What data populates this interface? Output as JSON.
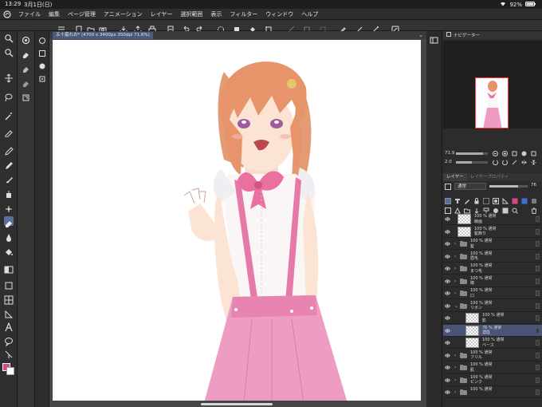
{
  "status": {
    "time": "13:29",
    "date": "3月1日(日)",
    "battery": "92%"
  },
  "menu": [
    "ファイル",
    "編集",
    "ページ管理",
    "アニメーション",
    "レイヤー",
    "選択範囲",
    "表示",
    "フィルター",
    "ウィンドウ",
    "ヘルプ"
  ],
  "canvas_tab": {
    "title": "五十嵐れお* (4700 x 3400px 350dpi 71.6%)"
  },
  "navigator": {
    "title": "ナビゲーター",
    "zoom": "71.9",
    "rotation": "2.0"
  },
  "layer_panel": {
    "tab_layer": "レイヤー",
    "tab_property": "レイヤープロパティ",
    "blend_mode": "通常",
    "opacity": "76",
    "opacity_fraction": 0.76,
    "layers": [
      {
        "meta": "100 % 通常",
        "name": "線画",
        "kind": "raster",
        "indent": 0
      },
      {
        "meta": "100 % 通常",
        "name": "髪飾り",
        "kind": "raster",
        "indent": 0
      },
      {
        "meta": "100 % 通常",
        "name": "髪",
        "kind": "folder",
        "indent": 0
      },
      {
        "meta": "100 % 通常",
        "name": "眉毛",
        "kind": "folder",
        "indent": 0
      },
      {
        "meta": "100 % 通常",
        "name": "まつ毛",
        "kind": "folder",
        "indent": 0
      },
      {
        "meta": "100 % 通常",
        "name": "瞳",
        "kind": "folder",
        "indent": 0
      },
      {
        "meta": "100 % 通常",
        "name": "口",
        "kind": "folder",
        "indent": 0
      },
      {
        "meta": "100 % 通常",
        "name": "リボン",
        "kind": "folder",
        "indent": 0,
        "open": true
      },
      {
        "meta": "100 % 通常",
        "name": "影",
        "kind": "raster",
        "indent": 1,
        "clip": true
      },
      {
        "meta": "76 % 通常",
        "name": "濃陰",
        "kind": "raster",
        "indent": 1,
        "clip": true,
        "selected": true
      },
      {
        "meta": "100 % 通常",
        "name": "ベース",
        "kind": "raster",
        "indent": 1
      },
      {
        "meta": "100 % 通常",
        "name": "フリル",
        "kind": "folder",
        "indent": 0
      },
      {
        "meta": "100 % 通常",
        "name": "肌",
        "kind": "folder",
        "indent": 0
      },
      {
        "meta": "100 % 通常",
        "name": "ピンク",
        "kind": "folder",
        "indent": 0
      },
      {
        "meta": "100 % 通常",
        "name": "",
        "kind": "folder",
        "indent": 0
      }
    ]
  },
  "colors": {
    "main": "#d44a86",
    "sub": "#ffffff",
    "accent": "#4a5478",
    "nav_frame": "#ff3a3a"
  },
  "icons": {
    "tools": [
      "zoom-icon",
      "hand-icon",
      "rotate-icon",
      "move-icon",
      "lasso-icon",
      "magic-wand-icon",
      "eyedropper-icon",
      "pen-icon",
      "pencil-icon",
      "brush-icon",
      "airbrush-icon",
      "decoration-icon",
      "eraser-icon",
      "blend-icon",
      "fill-icon",
      "gradient-icon",
      "figure-icon",
      "frame-icon",
      "ruler-icon",
      "text-icon",
      "balloon-icon",
      "correct-line-icon"
    ]
  }
}
